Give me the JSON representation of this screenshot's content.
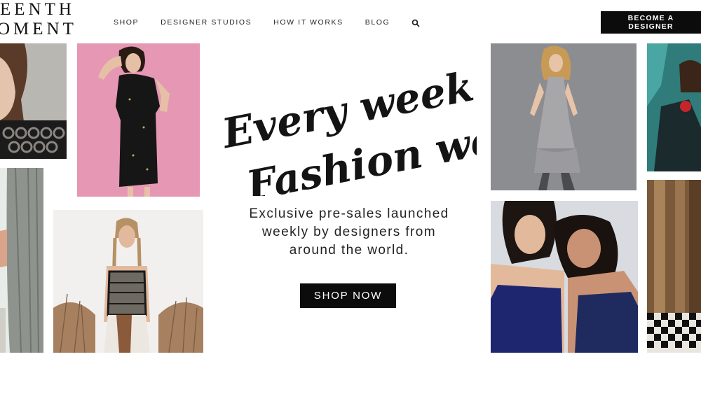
{
  "brand": {
    "logo_line1": "EENTH",
    "logo_line2": "OMENT"
  },
  "nav": {
    "items": [
      "SHOP",
      "DESIGNER STUDIOS",
      "HOW IT WORKS",
      "BLOG"
    ],
    "search_icon": "search-icon"
  },
  "header": {
    "cta_label": "BECOME A DESIGNER"
  },
  "hero": {
    "headline_line1": "Every week is",
    "headline_line2": "Fashion week",
    "subtext_line1": "Exclusive pre-sales launched",
    "subtext_line2": "weekly by designers from",
    "subtext_line3": "around the world.",
    "button_label": "SHOP NOW"
  },
  "colors": {
    "primary": "#0c0c0c",
    "text": "#222222",
    "background": "#ffffff",
    "pink_backdrop": "#e597b4"
  }
}
